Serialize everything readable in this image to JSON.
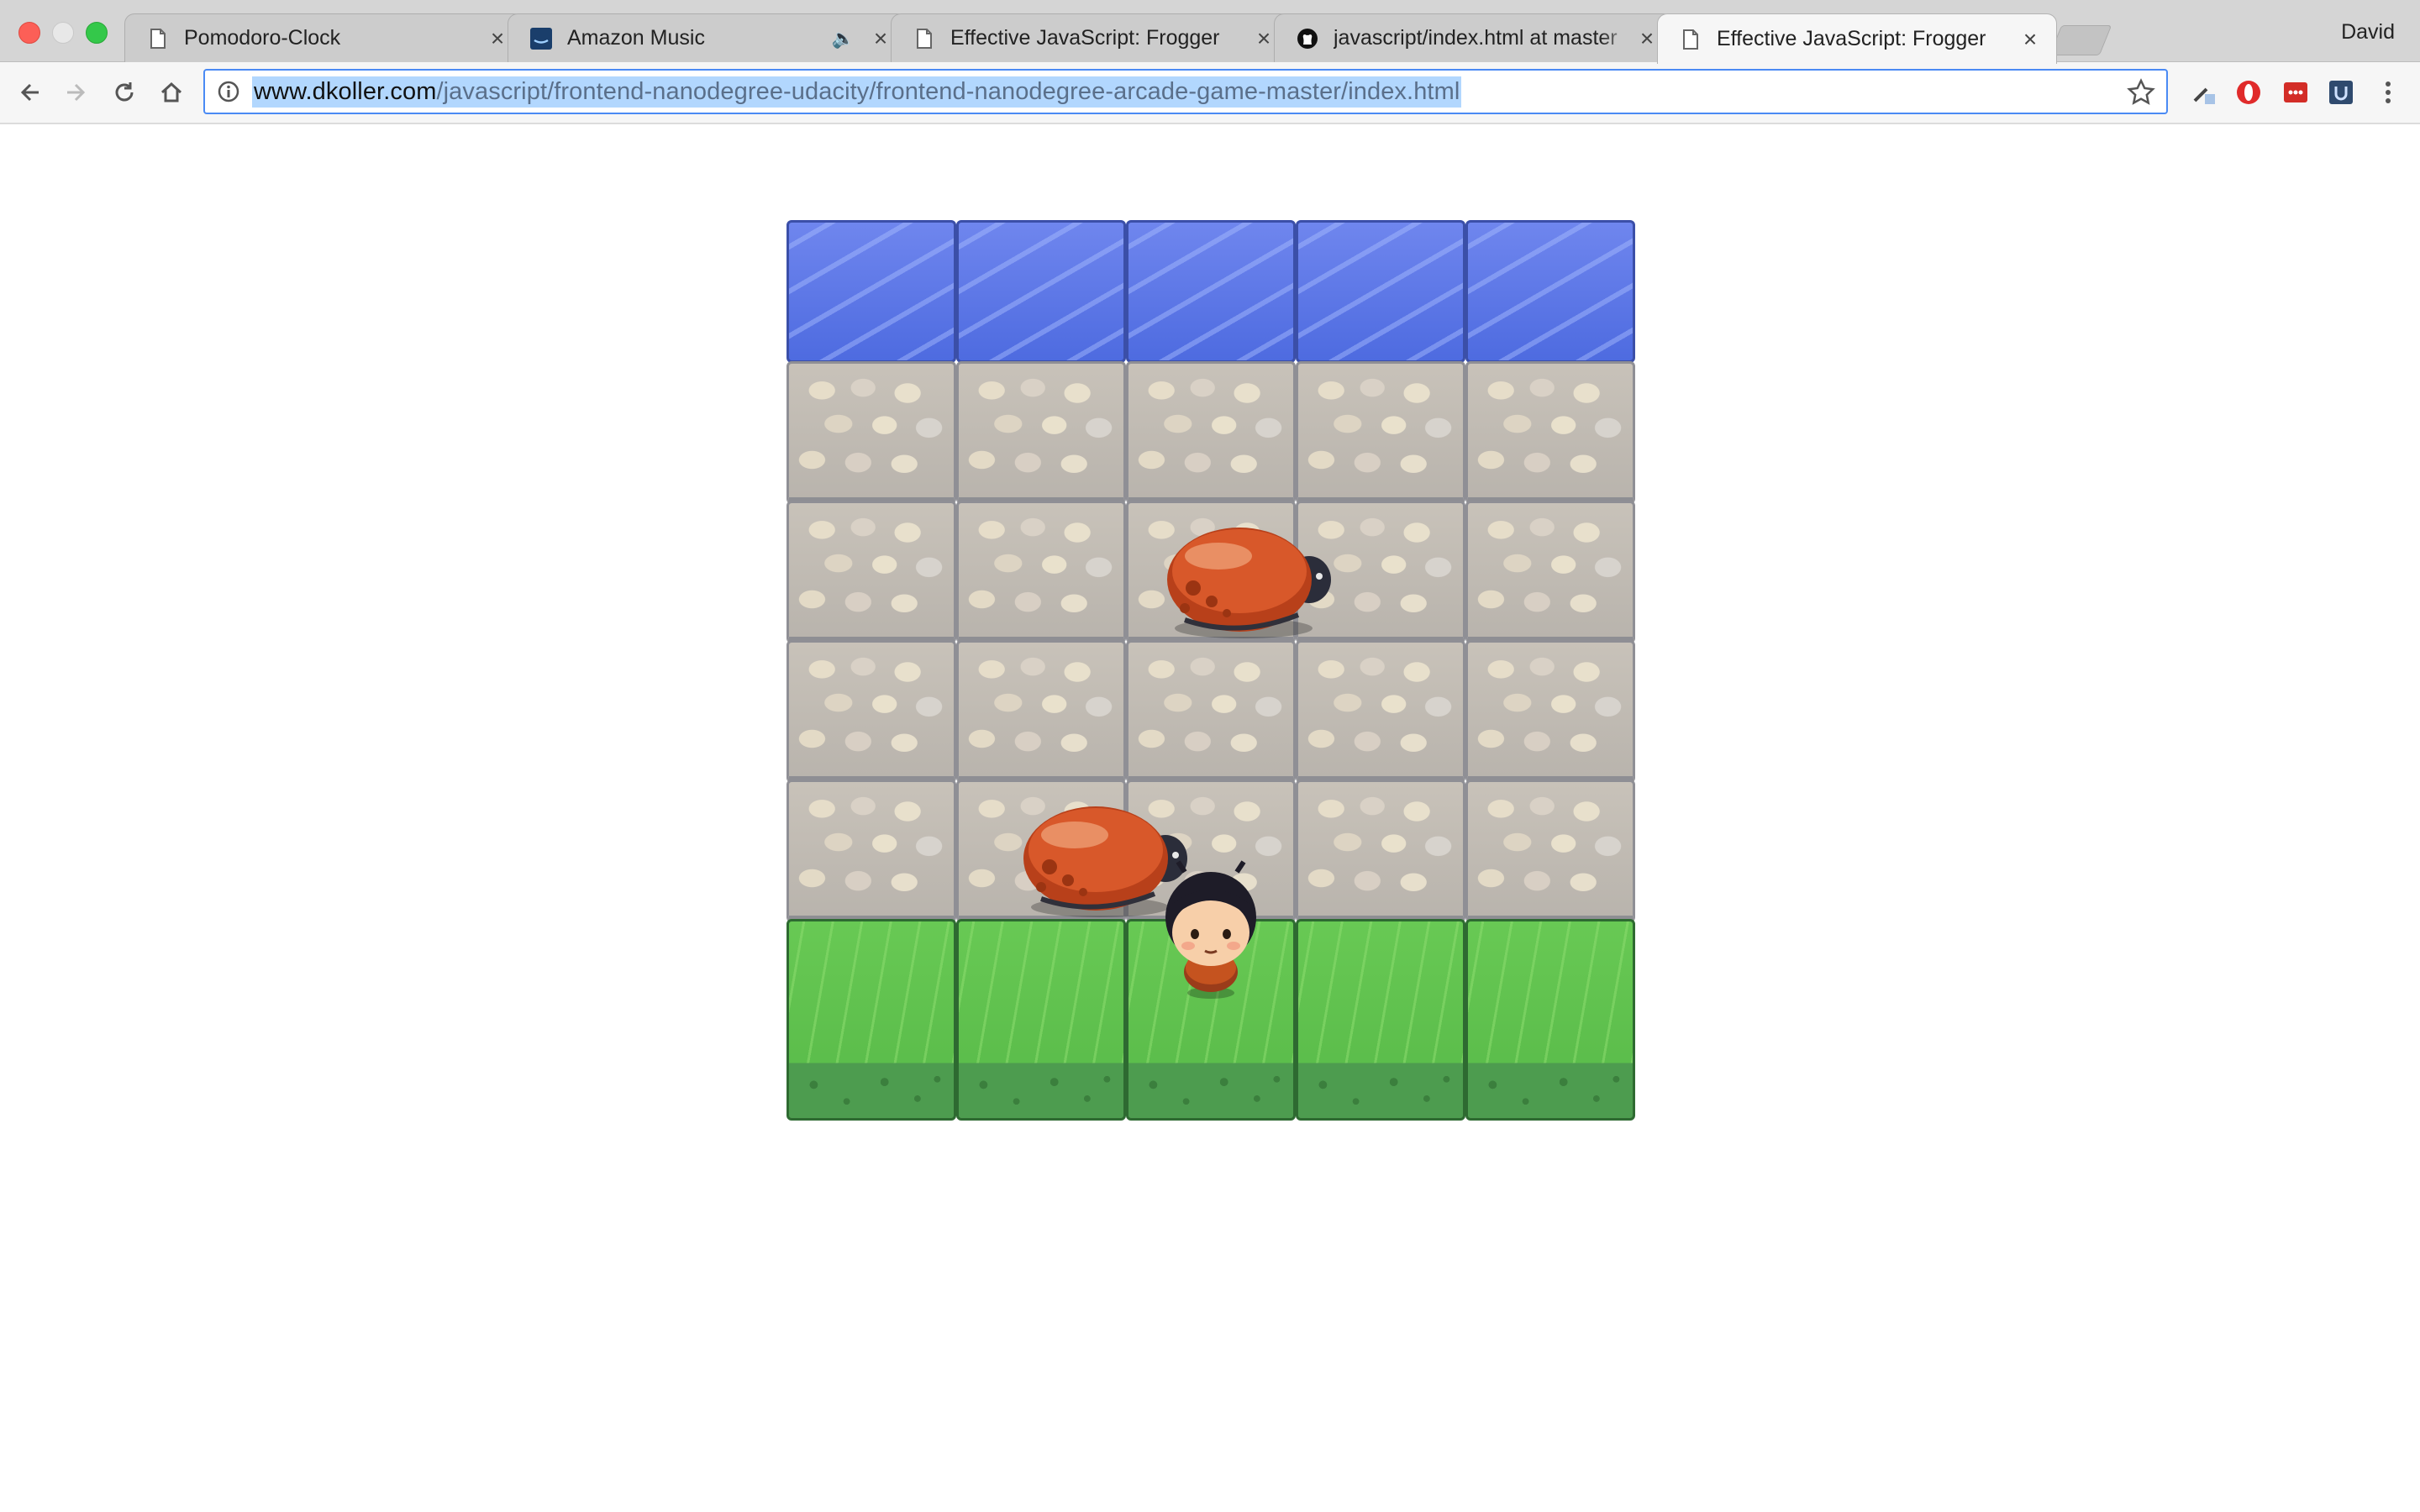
{
  "browser": {
    "tabs": [
      {
        "title": "Pomodoro-Clock",
        "icon": "page-icon",
        "active": false
      },
      {
        "title": "Amazon Music",
        "icon": "amazon-music-icon",
        "active": false,
        "audio": true
      },
      {
        "title": "Effective JavaScript: Frogger",
        "icon": "page-icon",
        "active": false
      },
      {
        "title": "javascript/index.html at master",
        "icon": "github-icon",
        "active": false
      },
      {
        "title": "Effective JavaScript: Frogger",
        "icon": "page-icon",
        "active": true
      }
    ],
    "close_glyph": "×",
    "audio_glyph": "🔈",
    "profile_name": "David",
    "url_domain": "www.dkoller.com",
    "url_path": "/javascript/frontend-nanodegree-udacity/frontend-nanodegree-arcade-game-master/index.html"
  },
  "game": {
    "columns": 5,
    "rows": [
      "water",
      "stone",
      "stone",
      "stone",
      "stone",
      "grass"
    ],
    "enemies": [
      {
        "name": "enemy-bug",
        "row": 2,
        "col": 2.2
      },
      {
        "name": "enemy-bug",
        "row": 4,
        "col": 1.35
      }
    ],
    "player": {
      "name": "player-boy",
      "row": 5,
      "col": 2
    }
  },
  "colors": {
    "omnibox_focus": "#4a8af4",
    "water": "#5b73e6",
    "stone": "#c8c2b9",
    "grass": "#5fc34f",
    "bug": "#c8481c"
  }
}
